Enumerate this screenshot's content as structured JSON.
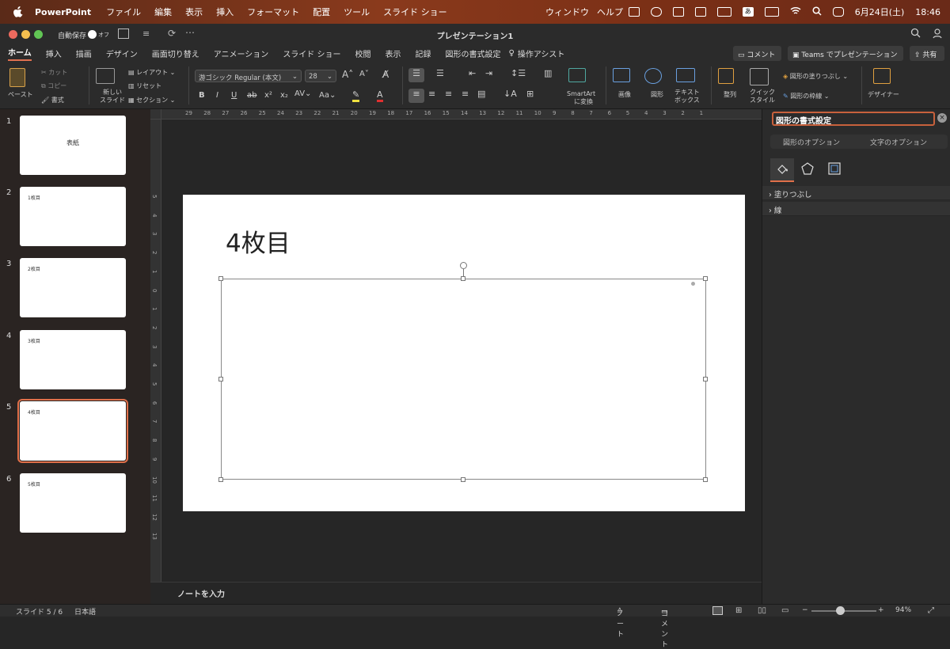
{
  "menubar": {
    "app_name": "PowerPoint",
    "items": [
      "ファイル",
      "編集",
      "表示",
      "挿入",
      "フォーマット",
      "配置",
      "ツール",
      "スライド ショー"
    ],
    "right_items": [
      "ウィンドウ",
      "ヘルプ"
    ],
    "date": "6月24日(土)",
    "time": "18:46"
  },
  "titlebar": {
    "autosave_label": "自動保存",
    "autosave_state": "オフ",
    "title": "プレゼンテーション1"
  },
  "tabs": [
    "ホーム",
    "挿入",
    "描画",
    "デザイン",
    "画面切り替え",
    "アニメーション",
    "スライド ショー",
    "校閲",
    "表示",
    "記録",
    "図形の書式設定"
  ],
  "tell_me": "操作アシスト",
  "header_buttons": {
    "comment": "コメント",
    "teams": "Teams でプレゼンテーション",
    "share": "共有"
  },
  "ribbon": {
    "paste": "ペースト",
    "cut": "カット",
    "copy": "コピー",
    "format": "書式",
    "new_slide_1": "新しい",
    "new_slide_2": "スライド",
    "layout": "レイアウト",
    "reset": "リセット",
    "section": "セクション",
    "font_name": "游ゴシック Regular (本文)",
    "font_size": "28",
    "smartart_1": "SmartArt",
    "smartart_2": "に変換",
    "image": "画像",
    "shapes": "図形",
    "textbox_1": "テキスト",
    "textbox_2": "ボックス",
    "arrange": "整列",
    "quick_style_1": "クイック",
    "quick_style_2": "スタイル",
    "shape_fill": "図形の塗りつぶし",
    "shape_outline": "図形の枠線",
    "designer": "デザイナー"
  },
  "slides": [
    {
      "num": "1",
      "title": "表紙"
    },
    {
      "num": "2",
      "title": "1枚目"
    },
    {
      "num": "3",
      "title": "2枚目"
    },
    {
      "num": "4",
      "title": "3枚目"
    },
    {
      "num": "5",
      "title": "4枚目",
      "selected": true
    },
    {
      "num": "6",
      "title": "5枚目"
    }
  ],
  "slide": {
    "title": "4枚目"
  },
  "ruler_h": [
    "29",
    "28",
    "27",
    "26",
    "25",
    "24",
    "23",
    "22",
    "21",
    "20",
    "19",
    "18",
    "17",
    "16",
    "15",
    "14",
    "13",
    "12",
    "11",
    "10",
    "9",
    "8",
    "7",
    "6",
    "5",
    "4",
    "3",
    "2",
    "1"
  ],
  "ruler_v": [
    "5",
    "4",
    "3",
    "2",
    "1",
    "0",
    "1",
    "2",
    "3",
    "4",
    "5",
    "6",
    "7",
    "8",
    "9",
    "10",
    "11",
    "12",
    "13"
  ],
  "notes_placeholder": "ノートを入力",
  "format_pane": {
    "title": "図形の書式設定",
    "tab_shape": "図形のオプション",
    "tab_text": "文字のオプション",
    "section_fill": "塗りつぶし",
    "section_line": "線"
  },
  "status": {
    "slide_info": "スライド 5 / 6",
    "language": "日本語",
    "notes": "ノート",
    "comments": "コメント",
    "zoom": "94%"
  },
  "colors": {
    "accent": "#e0704a",
    "menubar": "#8a3a1c"
  }
}
